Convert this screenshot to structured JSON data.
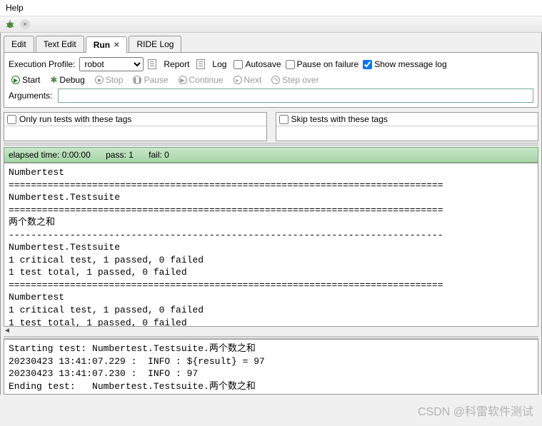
{
  "menubar": {
    "help": "Help"
  },
  "tabs": {
    "edit": "Edit",
    "textEdit": "Text Edit",
    "run": "Run",
    "rideLog": "RIDE Log"
  },
  "profile": {
    "label": "Execution Profile:",
    "value": "robot"
  },
  "actions": {
    "report": "Report",
    "log": "Log",
    "autosave": "Autosave",
    "pauseOnFailure": "Pause on failure",
    "showMessageLog": "Show message log"
  },
  "controls": {
    "start": "Start",
    "debug": "Debug",
    "stop": "Stop",
    "pause": "Pause",
    "continue": "Continue",
    "next": "Next",
    "stepOver": "Step over"
  },
  "arguments": {
    "label": "Arguments:",
    "value": ""
  },
  "tags": {
    "only": "Only run tests with these tags",
    "skip": "Skip tests with these tags"
  },
  "status": {
    "elapsed": "elapsed time: 0:00:00",
    "pass": "pass: 1",
    "fail": "fail: 0"
  },
  "console1": "Numbertest\n==============================================================================\nNumbertest.Testsuite\n==============================================================================\n两个数之和\n------------------------------------------------------------------------------\nNumbertest.Testsuite\n1 critical test, 1 passed, 0 failed\n1 test total, 1 passed, 0 failed\n==============================================================================\nNumbertest\n1 critical test, 1 passed, 0 failed\n1 test total, 1 passed, 0 failed",
  "console2": "Starting test: Numbertest.Testsuite.两个数之和\n20230423 13:41:07.229 :  INFO : ${result} = 97\n20230423 13:41:07.230 :  INFO : 97\nEnding test:   Numbertest.Testsuite.两个数之和",
  "watermark": "CSDN @科雷软件测试"
}
